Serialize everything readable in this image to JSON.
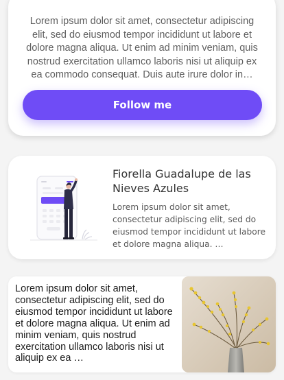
{
  "card_top": {
    "text": "Lorem ipsum dolor sit amet, consectetur adipiscing elit, sed do eiusmod tempor incididunt ut labore et dolore magna aliqua. Ut enim ad minim veniam, quis nostrud exercitation ullamco laboris nisi ut aliquip ex ea commodo consequat. Duis aute irure dolor in…",
    "button_label": "Follow me",
    "accent_color": "#6f4cf6"
  },
  "card_profile": {
    "name": "Fiorella Guadalupe de las Nieves Azules",
    "text": "Lorem ipsum dolor sit amet, consectetur adipiscing elit, sed do eiusmod tempor incididunt ut labore et dolore magna aliqua. …",
    "illustration_icon": "person-with-phone-illustration"
  },
  "card_media": {
    "text": "Lorem ipsum dolor sit amet, consectetur adipiscing elit, sed do eiusmod tempor incididunt ut labore et dolore magna aliqua. Ut enim ad minim veniam, quis nostrud exercitation ullamco laboris nisi ut aliquip ex ea …",
    "image_icon": "flower-vase-photo"
  }
}
